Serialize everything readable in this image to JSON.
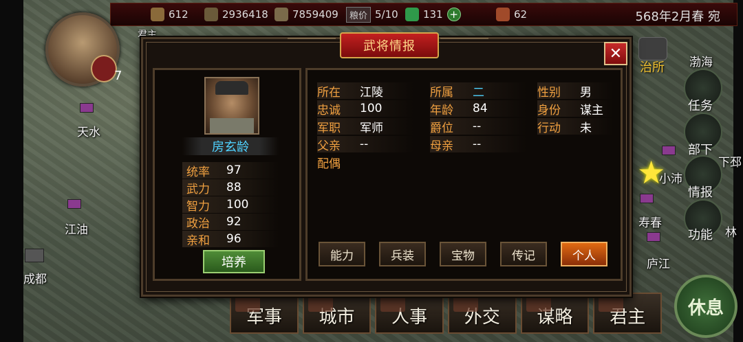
{
  "topbar": {
    "resource1": "612",
    "resource2": "2936418",
    "resource3": "7859409",
    "price_label": "粮价",
    "price_value": "5/10",
    "resource4": "131",
    "plus": "+",
    "resource5": "62",
    "date": "568年2月春 宛"
  },
  "player": {
    "level": "7"
  },
  "map": {
    "cities": [
      "天水",
      "江油",
      "成都",
      "渤海",
      "寿春",
      "庐江",
      "小沛",
      "下邳",
      "林"
    ],
    "partial_label": "君主",
    "partial_num": "二"
  },
  "side_menu": {
    "zhisuo": "治所",
    "renwu": "任务",
    "buxia": "部下",
    "qingbao": "情报",
    "gongneng": "功能",
    "rest": "休息"
  },
  "bottom_tabs": [
    "军事",
    "城市",
    "人事",
    "外交",
    "谋略",
    "君主"
  ],
  "dialog": {
    "title": "武将情报",
    "close": "✕",
    "general": {
      "name": "房玄龄",
      "stats": [
        {
          "label": "统率",
          "value": "97"
        },
        {
          "label": "武力",
          "value": "88"
        },
        {
          "label": "智力",
          "value": "100"
        },
        {
          "label": "政治",
          "value": "92"
        },
        {
          "label": "亲和",
          "value": "96"
        }
      ],
      "train_button": "培养"
    },
    "info": {
      "location_label": "所在",
      "location": "江陵",
      "faction_label": "所属",
      "faction": "二",
      "gender_label": "性别",
      "gender": "男",
      "loyalty_label": "忠诚",
      "loyalty": "100",
      "age_label": "年龄",
      "age": "84",
      "identity_label": "身份",
      "identity": "谋主",
      "post_label": "军职",
      "post": "军师",
      "rank_label": "爵位",
      "rank": "--",
      "action_label": "行动",
      "action": "未",
      "father_label": "父亲",
      "father": "--",
      "mother_label": "母亲",
      "mother": "--",
      "spouse_label": "配偶"
    },
    "tabs": [
      "能力",
      "兵装",
      "宝物",
      "传记",
      "个人"
    ],
    "active_tab": "个人"
  }
}
